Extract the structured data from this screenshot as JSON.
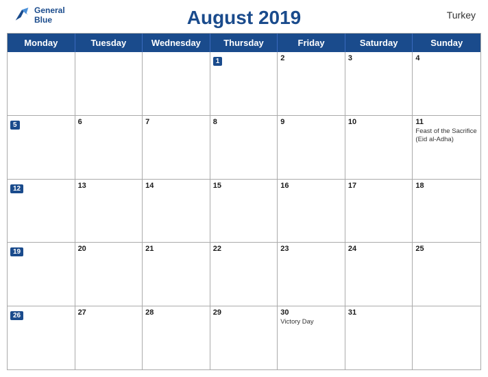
{
  "header": {
    "title": "August 2019",
    "country": "Turkey",
    "logo_general": "General",
    "logo_blue": "Blue"
  },
  "dayHeaders": [
    "Monday",
    "Tuesday",
    "Wednesday",
    "Thursday",
    "Friday",
    "Saturday",
    "Sunday"
  ],
  "weeks": [
    [
      {
        "day": "",
        "events": []
      },
      {
        "day": "",
        "events": []
      },
      {
        "day": "",
        "events": []
      },
      {
        "day": "1",
        "events": [],
        "blueNum": true
      },
      {
        "day": "2",
        "events": []
      },
      {
        "day": "3",
        "events": []
      },
      {
        "day": "4",
        "events": []
      }
    ],
    [
      {
        "day": "5",
        "events": [],
        "blueNum": true
      },
      {
        "day": "6",
        "events": []
      },
      {
        "day": "7",
        "events": []
      },
      {
        "day": "8",
        "events": []
      },
      {
        "day": "9",
        "events": []
      },
      {
        "day": "10",
        "events": []
      },
      {
        "day": "11",
        "events": [
          {
            "text": "Feast of the Sacrifice (Eid al-Adha)"
          }
        ]
      }
    ],
    [
      {
        "day": "12",
        "events": [],
        "blueNum": true
      },
      {
        "day": "13",
        "events": []
      },
      {
        "day": "14",
        "events": []
      },
      {
        "day": "15",
        "events": []
      },
      {
        "day": "16",
        "events": []
      },
      {
        "day": "17",
        "events": []
      },
      {
        "day": "18",
        "events": []
      }
    ],
    [
      {
        "day": "19",
        "events": [],
        "blueNum": true
      },
      {
        "day": "20",
        "events": []
      },
      {
        "day": "21",
        "events": []
      },
      {
        "day": "22",
        "events": []
      },
      {
        "day": "23",
        "events": []
      },
      {
        "day": "24",
        "events": []
      },
      {
        "day": "25",
        "events": []
      }
    ],
    [
      {
        "day": "26",
        "events": [],
        "blueNum": true
      },
      {
        "day": "27",
        "events": []
      },
      {
        "day": "28",
        "events": []
      },
      {
        "day": "29",
        "events": []
      },
      {
        "day": "30",
        "events": [
          {
            "text": "Victory Day"
          }
        ]
      },
      {
        "day": "31",
        "events": []
      },
      {
        "day": "",
        "events": []
      }
    ]
  ],
  "colors": {
    "headerBg": "#1a4b8c",
    "accent": "#1a4b8c"
  }
}
